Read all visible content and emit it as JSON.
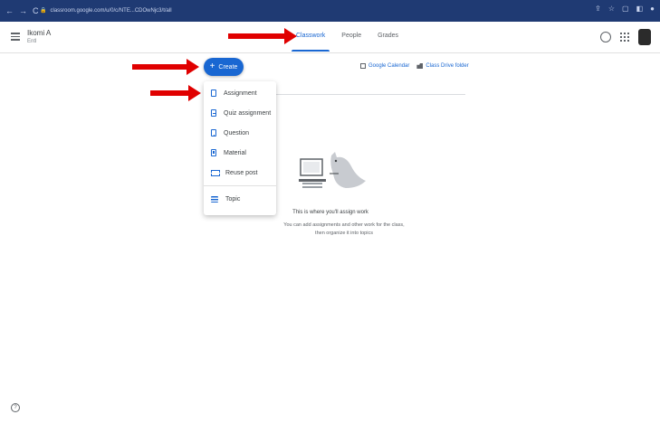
{
  "browser": {
    "nav": [
      "←",
      "→",
      "C"
    ],
    "url": "classroom.google.com/u/0/c/NTE...CDOwNjc3/t/all"
  },
  "header": {
    "class_name": "Ikomi A",
    "class_subtitle": "Entl",
    "tabs": [
      {
        "label": "Classwork",
        "active": true
      },
      {
        "label": "People",
        "active": false
      },
      {
        "label": "Grades",
        "active": false
      }
    ]
  },
  "toolbar": {
    "create_label": "Create",
    "calendar_label": "Google Calendar",
    "drive_label": "Class Drive folder"
  },
  "create_menu": {
    "items": [
      {
        "label": "Assignment",
        "icon": "assignment-icon"
      },
      {
        "label": "Quiz assignment",
        "icon": "quiz-icon"
      },
      {
        "label": "Question",
        "icon": "question-icon"
      },
      {
        "label": "Material",
        "icon": "material-icon"
      },
      {
        "label": "Reuse post",
        "icon": "reuse-icon"
      },
      {
        "label": "Topic",
        "icon": "topic-icon"
      }
    ]
  },
  "empty_state": {
    "title": "This is where you'll assign work",
    "subtitle_line1": "You can add assignments and other work for the class,",
    "subtitle_line2": "then organize it into topics"
  },
  "colors": {
    "accent": "#1967d2",
    "browser_bar": "#1f3a73",
    "annotation_arrow": "#e00000"
  }
}
